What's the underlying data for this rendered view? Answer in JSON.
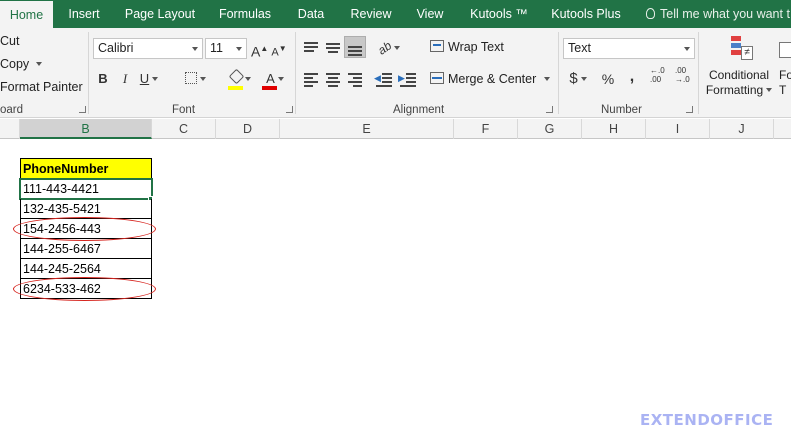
{
  "ribbon_tabs": [
    "Home",
    "Insert",
    "Page Layout",
    "Formulas",
    "Data",
    "Review",
    "View",
    "Kutools ™",
    "Kutools Plus"
  ],
  "tell_me": "Tell me what you want t",
  "clipboard": {
    "cut": "Cut",
    "copy": "Copy",
    "format_painter": "Format Painter",
    "group_label": "oard"
  },
  "font": {
    "name": "Calibri",
    "size": "11",
    "grow": "A",
    "shrink": "A",
    "bold": "B",
    "italic": "I",
    "underline": "U",
    "font_color_glyph": "A",
    "group_label": "Font"
  },
  "alignment": {
    "wrap_text": "Wrap Text",
    "merge_center": "Merge & Center",
    "group_label": "Alignment"
  },
  "number": {
    "format": "Text",
    "currency": "$",
    "percent": "%",
    "comma": ",",
    "inc_decimal": "←.0",
    "inc_decimal_sub": ".00",
    "dec_decimal": ".00",
    "dec_decimal_sub": "→.0",
    "group_label": "Number"
  },
  "styles": {
    "cond_line1": "Conditional",
    "cond_line2": "Formatting",
    "next_line1": "Fo",
    "next_line2": "T"
  },
  "columns": [
    "B",
    "C",
    "D",
    "E",
    "F",
    "G",
    "H",
    "I",
    "J"
  ],
  "sheet": {
    "header": "PhoneNumber",
    "rows": [
      "111-443-4421",
      "132-435-5421",
      "154-2456-443",
      "144-255-6467",
      "144-245-2564",
      "6234-533-462"
    ]
  },
  "colors": {
    "accent": "#217346",
    "highlight": "#ffff00",
    "annotation": "#d6251f",
    "font_color_bar": "#e00000",
    "fill_color_bar": "#ffff00"
  },
  "watermark": "EXTENDOFFICE"
}
